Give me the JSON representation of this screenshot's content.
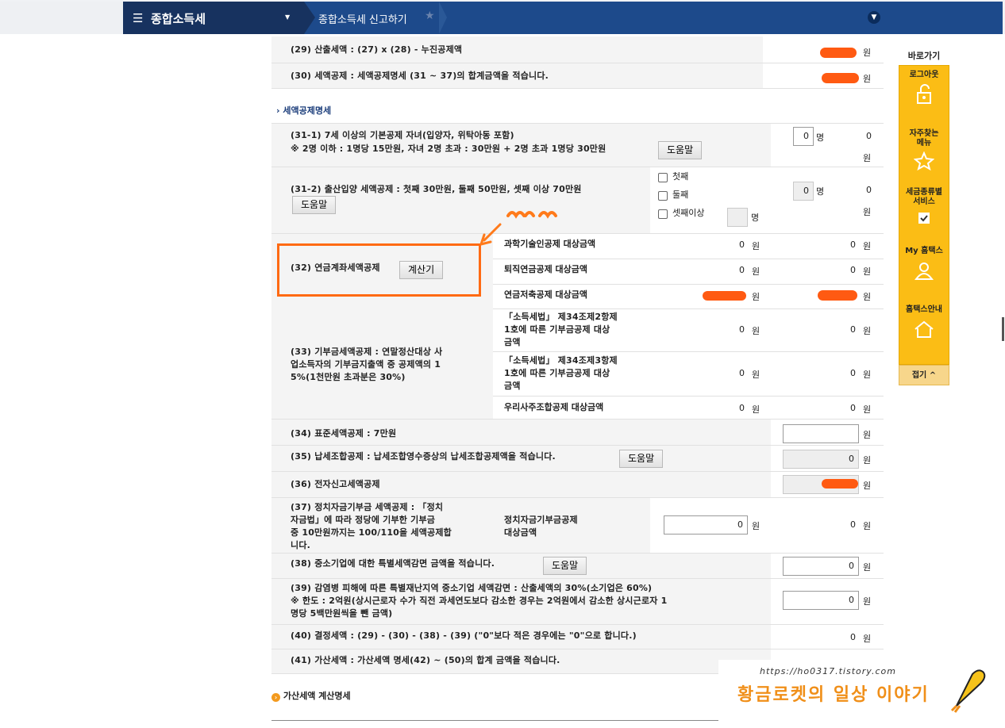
{
  "topbar": {
    "menu_title": "종합소득세",
    "breadcrumb": "종합소득세 신고하기"
  },
  "rows": {
    "r29": {
      "label": "(29) 산출세액 : (27) x (28) - 누진공제액",
      "unit": "원"
    },
    "r30": {
      "label": "(30) 세액공제 : 세액공제명세 (31 ~ 37)의 합계금액을 적습니다.",
      "unit": "원"
    },
    "section1": "세액공제명세",
    "r31_1": {
      "line1": "(31-1) 7세 이상의 기본공제 자녀(입양자, 위탁아동 포함)",
      "line2": "※ 2명 이하 : 1명당 15만원, 자녀 2명 초과 : 30만원 + 2명 초과 1명당 30만원",
      "help": "도움말",
      "count": "0",
      "count_unit": "명",
      "amount": "0",
      "unit": "원"
    },
    "r31_2": {
      "label": "(31-2) 출산입양 세액공제 : 첫째 30만원, 둘째 50만원, 셋째 이상 70만원",
      "help": "도움말",
      "opt1": "첫째",
      "opt2": "둘째",
      "opt3": "셋째이상",
      "opt3_unit": "명",
      "count": "0",
      "count_unit": "명",
      "amount": "0",
      "unit": "원"
    },
    "r32": {
      "label": "(32) 연금계좌세액공제",
      "calc": "계산기",
      "sub1": "과학기술인공제 대상금액",
      "sub1_a": "0",
      "sub1_b": "0",
      "sub2": "퇴직연금공제 대상금액",
      "sub2_a": "0",
      "sub2_b": "0",
      "sub3": "연금저축공제 대상금액",
      "unit": "원"
    },
    "r33": {
      "line1": "(33) 기부금세액공제 : 연말정산대상 사",
      "line2": "업소득자의 기부금지출액 중 공제액의 1",
      "line3": "5%(1천만원 초과분은 30%)",
      "sub1_l1": "「소득세법」 제34조제2항제",
      "sub1_l2": "1호에 따른 기부금공제 대상",
      "sub1_l3": "금액",
      "sub1_a": "0",
      "sub1_b": "0",
      "sub2_l1": "「소득세법」 제34조제3항제",
      "sub2_l2": "1호에 따른 기부금공제 대상",
      "sub2_l3": "금액",
      "sub2_a": "0",
      "sub2_b": "0",
      "sub3": "우리사주조합공제 대상금액",
      "sub3_a": "0",
      "sub3_b": "0",
      "unit": "원"
    },
    "r34": {
      "label": "(34) 표준세액공제 : 7만원",
      "unit": "원"
    },
    "r35": {
      "label": "(35) 납세조합공제 : 납세조합영수증상의 납세조합공제액을 적습니다.",
      "help": "도움말",
      "value": "0",
      "unit": "원"
    },
    "r36": {
      "label": "(36) 전자신고세액공제",
      "unit": "원"
    },
    "r37": {
      "line1": "(37) 정치자금기부금 세액공제 : 「정치",
      "line2": "자금법」에 따라 정당에 기부한 기부금",
      "line3": "중 10만원까지는 100/110을 세액공제합",
      "line4": "니다.",
      "sub_l1": "정치자금기부금공제",
      "sub_l2": "대상금액",
      "input": "0",
      "amount": "0",
      "unit": "원"
    },
    "r38": {
      "label": "(38) 중소기업에 대한 특별세액감면 금액을 적습니다.",
      "help": "도움말",
      "value": "0",
      "unit": "원"
    },
    "r39": {
      "line1": "(39) 감염병 피해에 따른 특별재난지역 중소기업 세액감면 : 산출세액의 30%(소기업은 60%)",
      "line2": "※ 한도 : 2억원(상시근로자 수가 직전 과세연도보다 감소한 경우는 2억원에서 감소한 상시근로자 1",
      "line3": "명당 5백만원씩을 뺀 금액)",
      "value": "0",
      "unit": "원"
    },
    "r40": {
      "label": "(40) 결정세액 : (29) - (30) - (38) - (39) (\"0\"보다 적은 경우에는 \"0\"으로 합니다.)",
      "value": "0",
      "unit": "원"
    },
    "r41": {
      "label": "(41) 가산세액 : 가산세액 명세(42) ~ (50)의 합계 금액을 적습니다."
    },
    "section2": "가산세액 계산명세"
  },
  "quick": {
    "title": "바로가기",
    "items": [
      "로그아웃",
      "자주찾는\n메뉴",
      "세금종류별\n서비스",
      "My 홈택스",
      "홈택스안내"
    ],
    "fold": "접기 ^"
  },
  "watermark": {
    "url": "https://ho0317.tistory.com",
    "name": "황금로켓의 일상 이야기"
  },
  "colors": {
    "nav_dark": "#17325f",
    "nav_blue": "#1d4a8b",
    "quick_yellow": "#fbbd15",
    "highlight": "#ff6a13"
  }
}
